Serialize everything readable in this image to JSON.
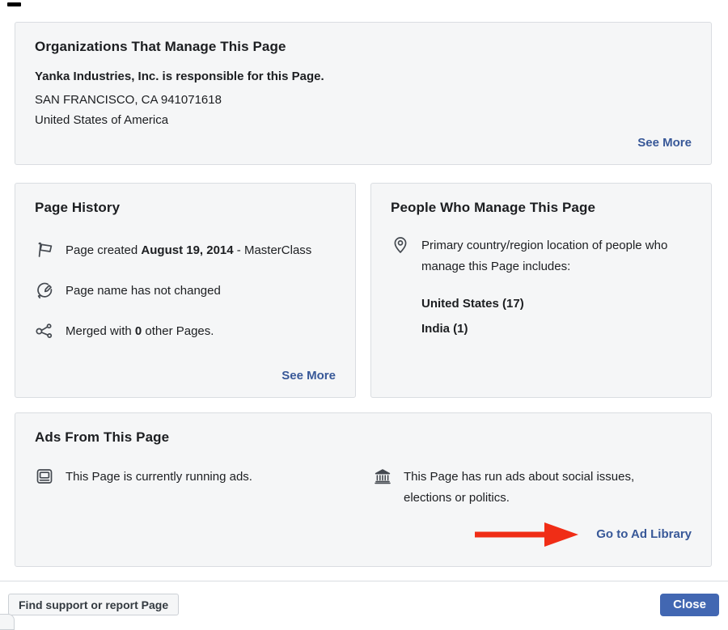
{
  "org_card": {
    "title": "Organizations That Manage This Page",
    "responsible": "Yanka Industries, Inc. is responsible for this Page.",
    "address_line1": "SAN FRANCISCO, CA 941071618",
    "address_line2": "United States of America",
    "see_more_label": "See More"
  },
  "history_card": {
    "title": "Page History",
    "created_prefix": "Page created ",
    "created_date": "August 19, 2014",
    "created_suffix": " - MasterClass",
    "name_unchanged_text": "Page name has not changed",
    "merged_prefix": "Merged with ",
    "merged_count": "0",
    "merged_suffix": " other Pages.",
    "see_more_label": "See More"
  },
  "people_card": {
    "title": "People Who Manage This Page",
    "location_text": "Primary country/region location of people who manage this Page includes:",
    "countries": [
      "United States (17)",
      "India (1)"
    ]
  },
  "ads_card": {
    "title": "Ads From This Page",
    "running_ads_text": "This Page is currently running ads.",
    "political_ads_text": "This Page has run ads about social issues, elections or politics.",
    "ad_library_label": "Go to Ad Library"
  },
  "footer": {
    "support_label": "Find support or report Page",
    "close_label": "Close"
  },
  "colors": {
    "card_bg": "#f5f6f7",
    "card_border": "#dadde1",
    "text": "#1c1e21",
    "link_blue": "#385898",
    "close_button_blue": "#4267b2",
    "icon_gray": "#444950",
    "arrow_red": "#f02d16"
  }
}
